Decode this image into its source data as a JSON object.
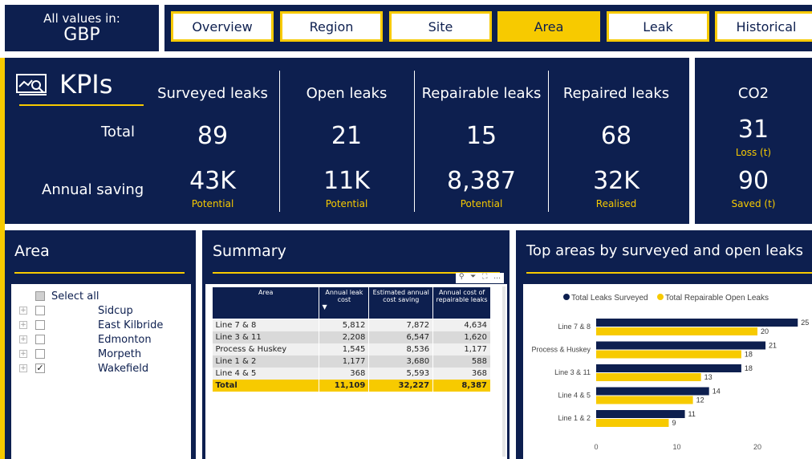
{
  "currency": {
    "label": "All values in:",
    "value": "GBP"
  },
  "tabs": [
    {
      "label": "Overview",
      "active": false
    },
    {
      "label": "Region",
      "active": false
    },
    {
      "label": "Site",
      "active": false
    },
    {
      "label": "Area",
      "active": true
    },
    {
      "label": "Leak",
      "active": false
    },
    {
      "label": "Historical",
      "active": false
    }
  ],
  "kpi": {
    "title": "KPIs",
    "row_total": "Total",
    "row_saving": "Annual saving",
    "columns": [
      {
        "header": "Surveyed leaks",
        "total": "89",
        "saving": "43K",
        "saving_sub": "Potential"
      },
      {
        "header": "Open leaks",
        "total": "21",
        "saving": "11K",
        "saving_sub": "Potential"
      },
      {
        "header": "Repairable leaks",
        "total": "15",
        "saving": "8,387",
        "saving_sub": "Potential"
      },
      {
        "header": "Repaired leaks",
        "total": "68",
        "saving": "32K",
        "saving_sub": "Realised"
      }
    ]
  },
  "co2": {
    "header": "CO2",
    "loss": "31",
    "loss_sub": "Loss (t)",
    "saved": "90",
    "saved_sub": "Saved (t)"
  },
  "area_slicer": {
    "title": "Area",
    "select_all": "Select all",
    "items": [
      {
        "label": "Sidcup",
        "checked": false
      },
      {
        "label": "East Kilbride",
        "checked": false
      },
      {
        "label": "Edmonton",
        "checked": false
      },
      {
        "label": "Morpeth",
        "checked": false
      },
      {
        "label": "Wakefield",
        "checked": true
      }
    ]
  },
  "summary": {
    "title": "Summary",
    "headers": [
      "Area",
      "Annual leak cost",
      "Estimated annual cost saving",
      "Annual cost of repairable leaks"
    ],
    "rows": [
      [
        "Line 7 & 8",
        "5,812",
        "7,872",
        "4,634"
      ],
      [
        "Line 3 & 11",
        "2,208",
        "6,547",
        "1,620"
      ],
      [
        "Process & Huskey",
        "1,545",
        "8,536",
        "1,177"
      ],
      [
        "Line 1 & 2",
        "1,177",
        "3,680",
        "588"
      ],
      [
        "Line 4 & 5",
        "368",
        "5,593",
        "368"
      ]
    ],
    "total": [
      "Total",
      "11,109",
      "32,227",
      "8,387"
    ]
  },
  "top_areas": {
    "title": "Top areas by surveyed and open leaks"
  },
  "colors": {
    "navy": "#0d1f4f",
    "yellow": "#f7ca00"
  },
  "chart_data": {
    "type": "bar",
    "orientation": "horizontal",
    "categories": [
      "Line 7 & 8",
      "Process & Huskey",
      "Line 3 & 11",
      "Line 4 & 5",
      "Line 1 & 2"
    ],
    "series": [
      {
        "name": "Total Leaks Surveyed",
        "values": [
          25,
          21,
          18,
          14,
          11
        ],
        "color": "#0d1f4f"
      },
      {
        "name": "Total Repairable Open Leaks",
        "values": [
          20,
          18,
          13,
          12,
          9
        ],
        "color": "#f7ca00"
      }
    ],
    "xlim": [
      0,
      26
    ],
    "xticks": [
      "0",
      "10",
      "20"
    ],
    "legend": "top-center"
  }
}
